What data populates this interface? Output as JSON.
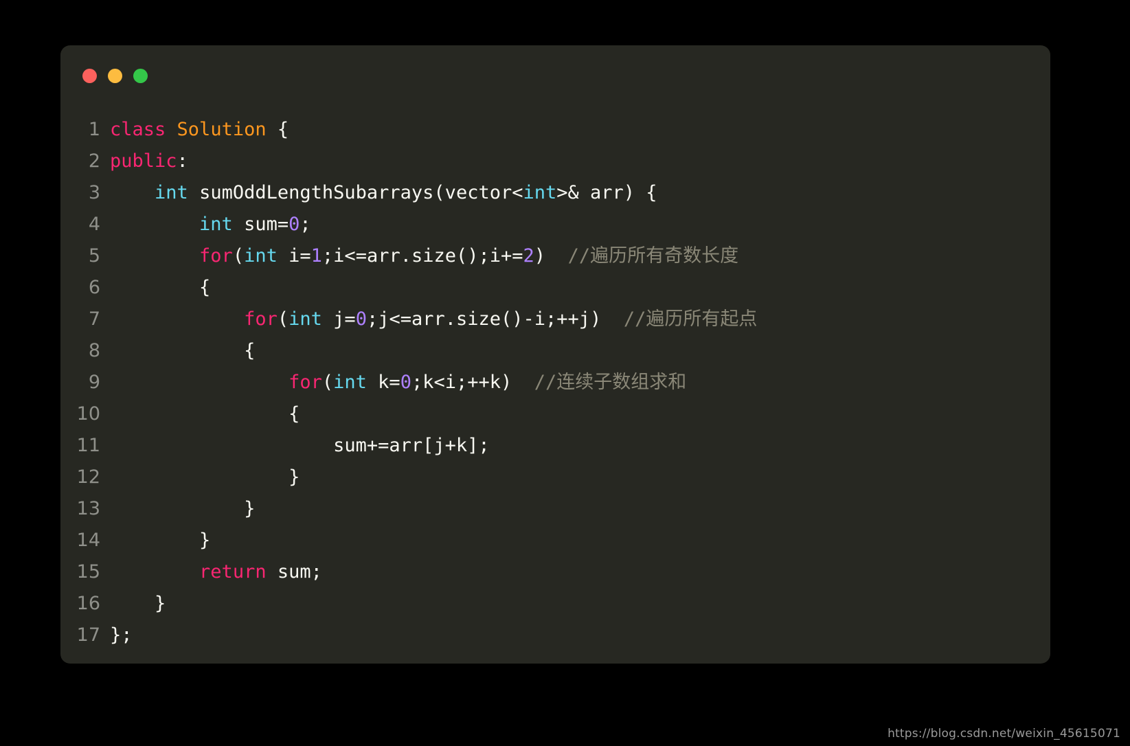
{
  "window": {
    "traffic_lights": [
      {
        "name": "close",
        "color": "#fc615d"
      },
      {
        "name": "minimize",
        "color": "#fdbc40"
      },
      {
        "name": "maximize",
        "color": "#34c749"
      }
    ]
  },
  "editor": {
    "language": "cpp",
    "background": "#272822",
    "line_number_color": "#8f908a",
    "colors": {
      "keyword": "#f92672",
      "type": "#66d9ef",
      "class_name": "#fd971f",
      "number": "#ae81ff",
      "plain": "#f8f8f2",
      "comment": "#8a8777"
    },
    "lines": [
      {
        "number": "1",
        "tokens": [
          {
            "t": "class",
            "c": "keyword"
          },
          {
            "t": " ",
            "c": "plain"
          },
          {
            "t": "Solution",
            "c": "class"
          },
          {
            "t": " {",
            "c": "plain"
          }
        ]
      },
      {
        "number": "2",
        "tokens": [
          {
            "t": "public",
            "c": "keyword"
          },
          {
            "t": ":",
            "c": "plain"
          }
        ]
      },
      {
        "number": "3",
        "tokens": [
          {
            "t": "    ",
            "c": "plain"
          },
          {
            "t": "int",
            "c": "type"
          },
          {
            "t": " sumOddLengthSubarrays(vector<",
            "c": "plain"
          },
          {
            "t": "int",
            "c": "type"
          },
          {
            "t": ">& arr) {",
            "c": "plain"
          }
        ]
      },
      {
        "number": "4",
        "tokens": [
          {
            "t": "        ",
            "c": "plain"
          },
          {
            "t": "int",
            "c": "type"
          },
          {
            "t": " sum=",
            "c": "plain"
          },
          {
            "t": "0",
            "c": "number"
          },
          {
            "t": ";",
            "c": "plain"
          }
        ]
      },
      {
        "number": "5",
        "tokens": [
          {
            "t": "        ",
            "c": "plain"
          },
          {
            "t": "for",
            "c": "keyword"
          },
          {
            "t": "(",
            "c": "plain"
          },
          {
            "t": "int",
            "c": "type"
          },
          {
            "t": " i=",
            "c": "plain"
          },
          {
            "t": "1",
            "c": "number"
          },
          {
            "t": ";i<=arr.size();i+=",
            "c": "plain"
          },
          {
            "t": "2",
            "c": "number"
          },
          {
            "t": ")",
            "c": "plain"
          },
          {
            "t": "  //遍历所有奇数长度",
            "c": "comment"
          }
        ]
      },
      {
        "number": "6",
        "tokens": [
          {
            "t": "        {",
            "c": "plain"
          }
        ]
      },
      {
        "number": "7",
        "tokens": [
          {
            "t": "            ",
            "c": "plain"
          },
          {
            "t": "for",
            "c": "keyword"
          },
          {
            "t": "(",
            "c": "plain"
          },
          {
            "t": "int",
            "c": "type"
          },
          {
            "t": " j=",
            "c": "plain"
          },
          {
            "t": "0",
            "c": "number"
          },
          {
            "t": ";j<=arr.size()-i;++j)",
            "c": "plain"
          },
          {
            "t": "  //遍历所有起点",
            "c": "comment"
          }
        ]
      },
      {
        "number": "8",
        "tokens": [
          {
            "t": "            {",
            "c": "plain"
          }
        ]
      },
      {
        "number": "9",
        "tokens": [
          {
            "t": "                ",
            "c": "plain"
          },
          {
            "t": "for",
            "c": "keyword"
          },
          {
            "t": "(",
            "c": "plain"
          },
          {
            "t": "int",
            "c": "type"
          },
          {
            "t": " k=",
            "c": "plain"
          },
          {
            "t": "0",
            "c": "number"
          },
          {
            "t": ";k<i;++k)",
            "c": "plain"
          },
          {
            "t": "  //连续子数组求和",
            "c": "comment"
          }
        ]
      },
      {
        "number": "10",
        "tokens": [
          {
            "t": "                {",
            "c": "plain"
          }
        ]
      },
      {
        "number": "11",
        "tokens": [
          {
            "t": "                    sum+=arr[j+k];",
            "c": "plain"
          }
        ]
      },
      {
        "number": "12",
        "tokens": [
          {
            "t": "                }",
            "c": "plain"
          }
        ]
      },
      {
        "number": "13",
        "tokens": [
          {
            "t": "            }",
            "c": "plain"
          }
        ]
      },
      {
        "number": "14",
        "tokens": [
          {
            "t": "        }",
            "c": "plain"
          }
        ]
      },
      {
        "number": "15",
        "tokens": [
          {
            "t": "        ",
            "c": "plain"
          },
          {
            "t": "return",
            "c": "keyword"
          },
          {
            "t": " sum;",
            "c": "plain"
          }
        ]
      },
      {
        "number": "16",
        "tokens": [
          {
            "t": "    }",
            "c": "plain"
          }
        ]
      },
      {
        "number": "17",
        "tokens": [
          {
            "t": "};",
            "c": "plain"
          }
        ]
      }
    ]
  },
  "watermark": {
    "text": "https://blog.csdn.net/weixin_45615071"
  }
}
